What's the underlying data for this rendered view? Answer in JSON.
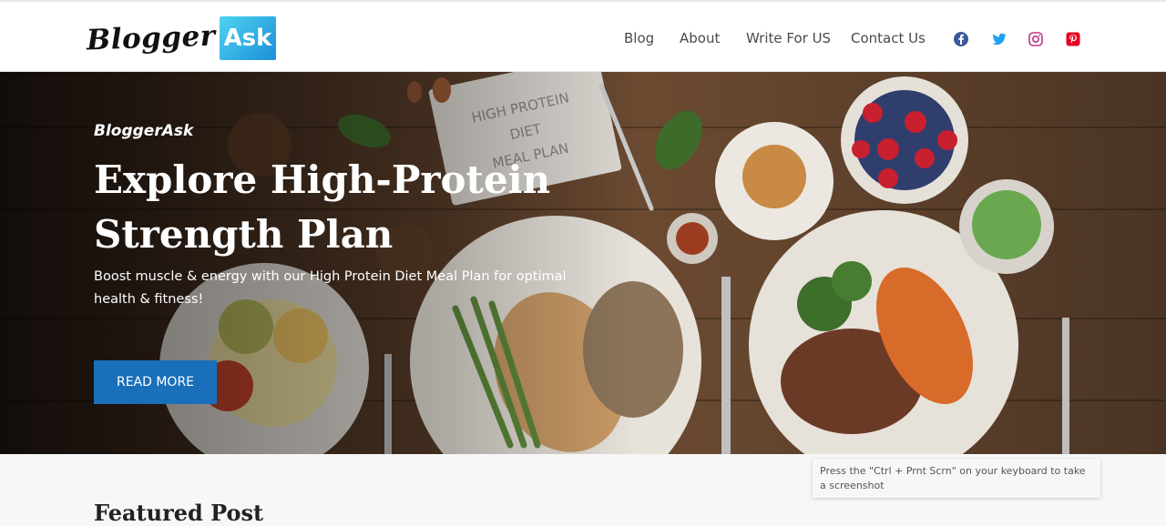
{
  "logo": {
    "part1": "Blogger",
    "part2": "Ask"
  },
  "nav": {
    "items": [
      {
        "label": "Blog"
      },
      {
        "label": "About"
      },
      {
        "label": "Write For US"
      },
      {
        "label": "Contact Us"
      }
    ]
  },
  "social": [
    {
      "icon": "facebook-icon",
      "color": "#3b5998"
    },
    {
      "icon": "twitter-icon",
      "color": "#1da1f2"
    },
    {
      "icon": "instagram-icon",
      "color": "#c13584"
    },
    {
      "icon": "pinterest-icon",
      "color": "#e60023"
    }
  ],
  "hero": {
    "kicker": "BloggerAsk",
    "title": "Explore High-Protein Strength Plan",
    "description": "Boost muscle & energy with our High Protein Diet Meal Plan for optimal health & fitness!",
    "button_label": "READ MORE",
    "card_text": "HIGH PROTEIN DIET MEAL PLAN"
  },
  "tooltip": {
    "text": "Press the \"Ctrl + Prnt Scrn\" on your keyboard to take a screenshot"
  },
  "section": {
    "heading": "Featured Post"
  },
  "colors": {
    "accent": "#1a6fba"
  }
}
